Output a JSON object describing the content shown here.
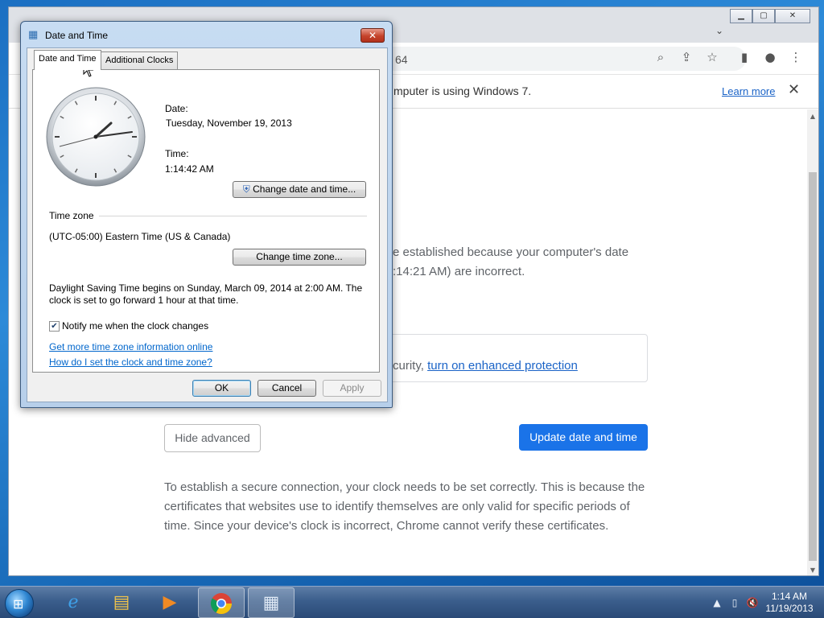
{
  "chrome": {
    "url_fragment": "64",
    "infobar_text": "mputer is using Windows 7.",
    "learn_more": "Learn more",
    "content": {
      "para1_line1": "e established because your computer's date",
      "para1_line2": ":14:21 AM) are incorrect.",
      "protect_prefix": "curity, ",
      "protect_link": "turn on enhanced protection",
      "hide_advanced": "Hide advanced",
      "update_button": "Update date and time",
      "para2": "To establish a secure connection, your clock needs to be set correctly. This is because the certificates that websites use to identify themselves are only valid for specific periods of time. Since your device's clock is incorrect, Chrome cannot verify these certificates."
    }
  },
  "dialog": {
    "title": "Date and Time",
    "tabs": [
      {
        "label": "Date and Time",
        "selected": true
      },
      {
        "label": "Additional Clocks",
        "selected": false
      }
    ],
    "date_label": "Date:",
    "date_value": "Tuesday, November 19, 2013",
    "time_label": "Time:",
    "time_value": "1:14:42 AM",
    "change_datetime_button": "Change date and time...",
    "timezone_heading": "Time zone",
    "timezone_value": "(UTC-05:00) Eastern Time (US & Canada)",
    "change_timezone_button": "Change time zone...",
    "dst_line1": "Daylight Saving Time begins on Sunday, March 09, 2014 at 2:00 AM. The",
    "dst_line2": "clock is set to go forward 1 hour at that time.",
    "notify_label": "Notify me when the clock changes",
    "notify_checked": true,
    "link_more_info": "Get more time zone information online",
    "link_howto": "How do I set the clock and time zone?",
    "ok_button": "OK",
    "cancel_button": "Cancel",
    "apply_button": "Apply"
  },
  "taskbar": {
    "apps": [
      "start",
      "internet-explorer",
      "windows-explorer",
      "media-player",
      "chrome",
      "date-time-control-panel"
    ],
    "clock_time": "1:14 AM",
    "clock_date": "11/19/2013"
  },
  "colors": {
    "chrome_accent": "#1a73e8",
    "link_blue": "#1a63c7",
    "dialog_frame": "#b7cfea"
  }
}
